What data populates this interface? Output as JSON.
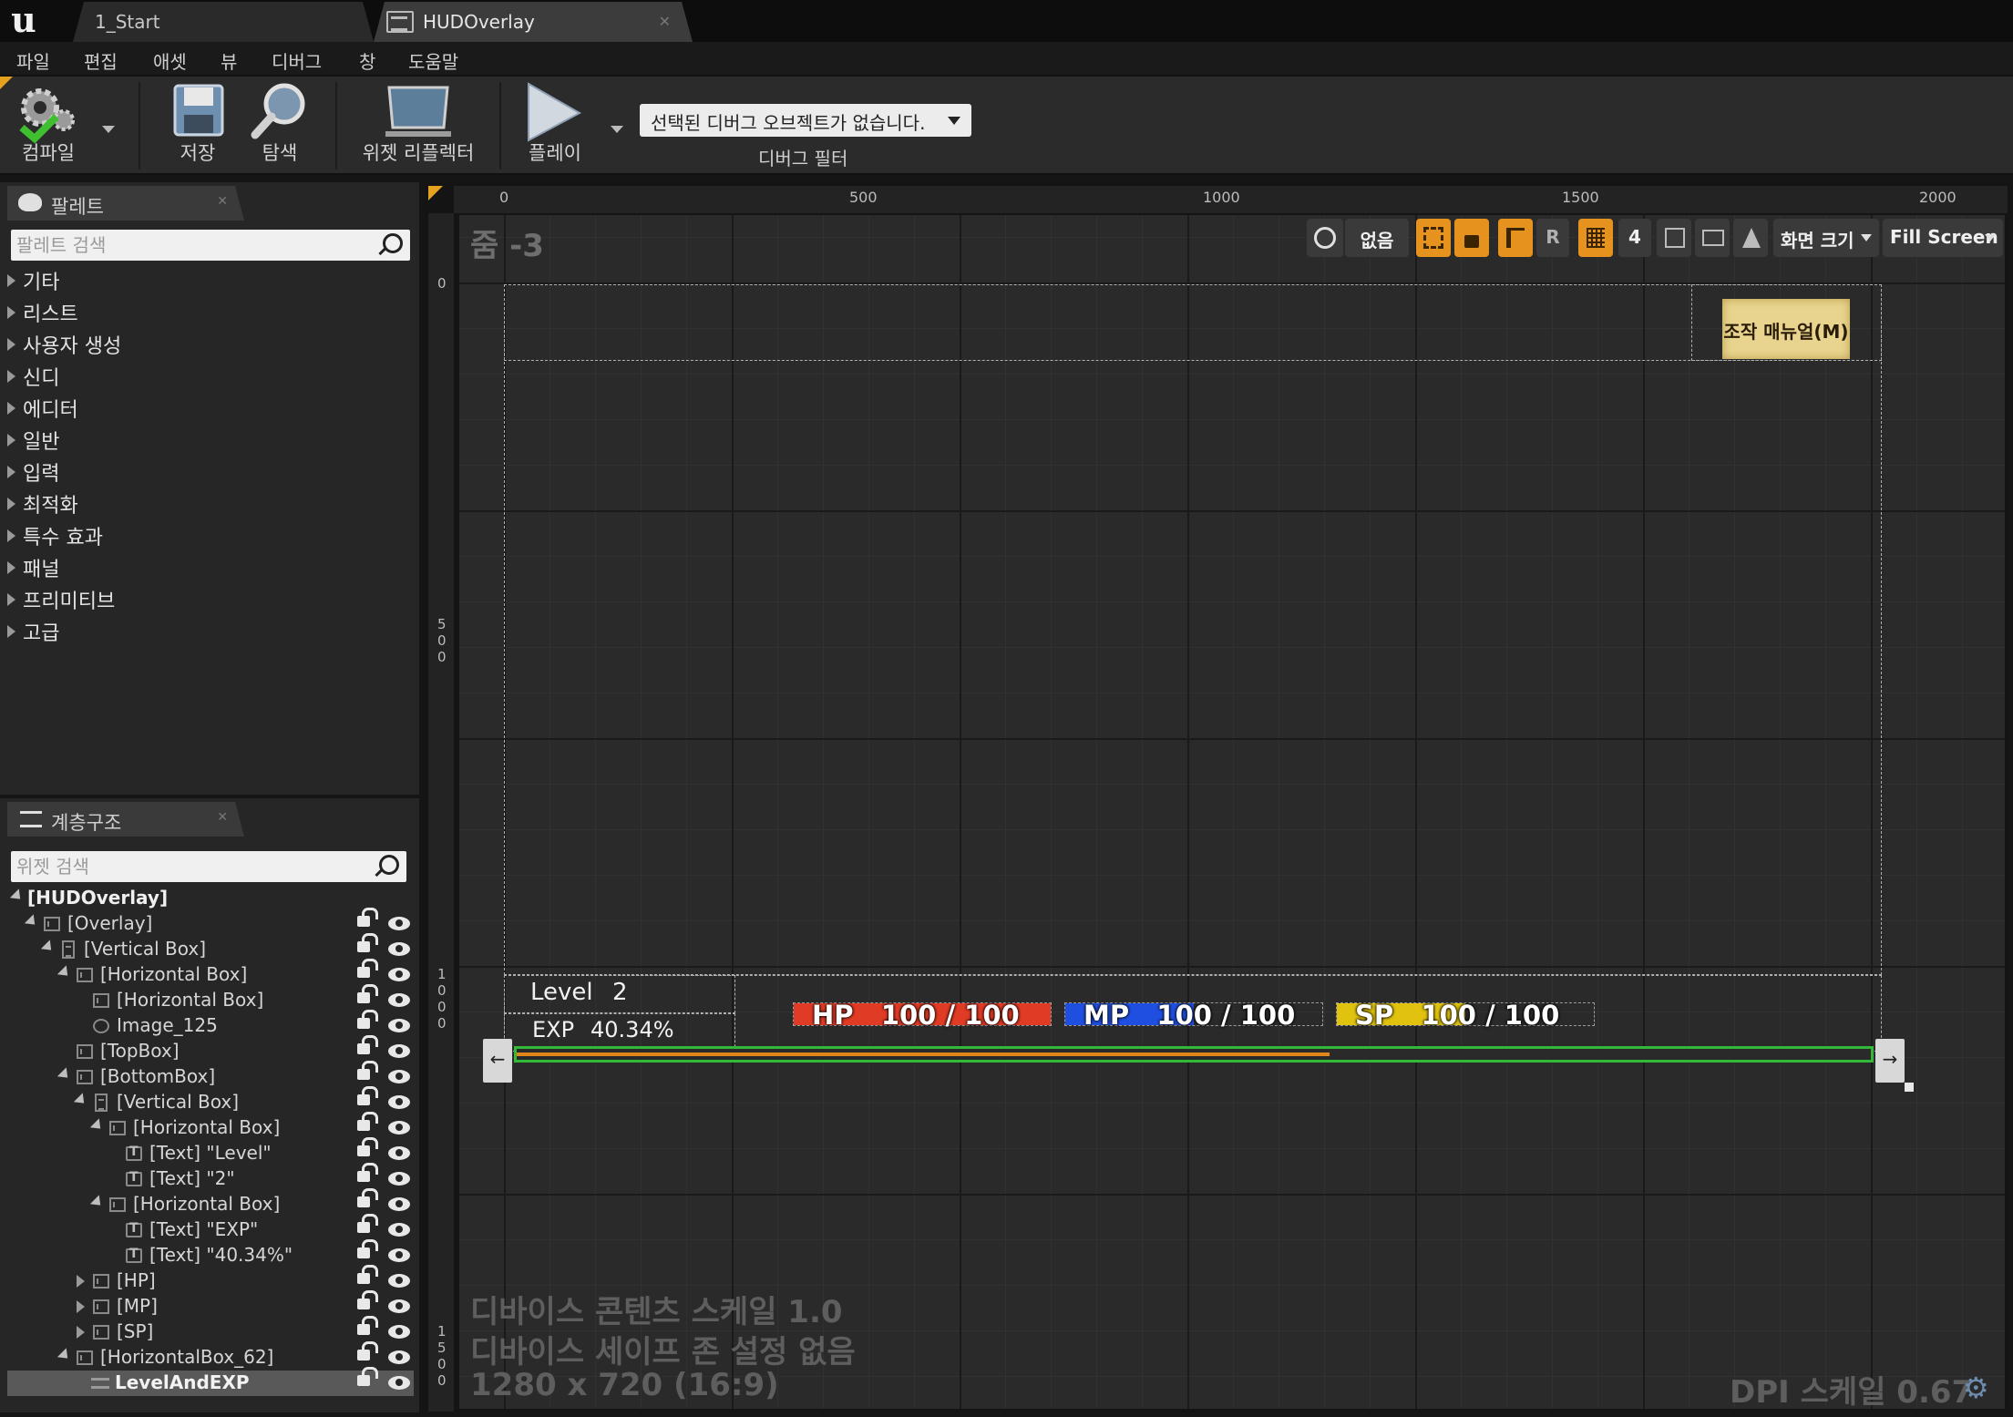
{
  "tabs": [
    {
      "label": "1_Start"
    },
    {
      "label": "HUDOverlay"
    }
  ],
  "menu": [
    "파일",
    "편집",
    "애셋",
    "뷰",
    "디버그",
    "창",
    "도움말"
  ],
  "toolbar": {
    "compile": "컴파일",
    "save": "저장",
    "browse": "탐색",
    "widget_reflector": "위젯 리플렉터",
    "play": "플레이",
    "debug_select": "선택된 디버그 오브젝트가 없습니다.",
    "debug_filter": "디버그 필터"
  },
  "palette": {
    "title": "팔레트",
    "search_placeholder": "팔레트 검색",
    "categories": [
      "기타",
      "리스트",
      "사용자 생성",
      "신디",
      "에디터",
      "일반",
      "입력",
      "최적화",
      "특수 효과",
      "패널",
      "프리미티브",
      "고급"
    ]
  },
  "hierarchy": {
    "title": "계층구조",
    "search_placeholder": "위젯 검색",
    "items": [
      {
        "label": "[HUDOverlay]"
      },
      {
        "label": "[Overlay]"
      },
      {
        "label": "[Vertical Box]"
      },
      {
        "label": "[Horizontal Box]"
      },
      {
        "label": "[Horizontal Box]"
      },
      {
        "label": "Image_125"
      },
      {
        "label": "[TopBox]"
      },
      {
        "label": "[BottomBox]"
      },
      {
        "label": "[Vertical Box]"
      },
      {
        "label": "[Horizontal Box]"
      },
      {
        "label": "[Text] \"Level\""
      },
      {
        "label": "[Text] \"2\""
      },
      {
        "label": "[Horizontal Box]"
      },
      {
        "label": "[Text] \"EXP\""
      },
      {
        "label": "[Text] \"40.34%\""
      },
      {
        "label": "[HP]"
      },
      {
        "label": "[MP]"
      },
      {
        "label": "[SP]"
      },
      {
        "label": "[HorizontalBox_62]"
      },
      {
        "label": "LevelAndEXP"
      }
    ]
  },
  "designer": {
    "zoom": "줌 -3",
    "ruler_top": [
      "0",
      "500",
      "1000",
      "1500",
      "2000"
    ],
    "ruler_left": [
      [
        "0"
      ],
      [
        "5",
        "0",
        "0"
      ],
      [
        "1",
        "0",
        "0",
        "0"
      ],
      [
        "1",
        "5",
        "0",
        "0"
      ]
    ],
    "tool_none": "없음",
    "tool_r": "R",
    "tool_grid_size": "4",
    "screen_size": "화면 크기",
    "fill_screen": "Fill Screen",
    "manual_button": "조작 매뉴얼(M)",
    "level_label": "Level",
    "level_value": "2",
    "exp_label": "EXP",
    "exp_value": "40.34%",
    "hp_label": "HP",
    "hp_value": "100 / 100",
    "mp_label": "MP",
    "mp_value": "100 / 100",
    "sp_label": "SP",
    "sp_value": "100 / 100",
    "device_scale": "디바이스 콘텐츠 스케일 1.0",
    "safe_zone": "디바이스 세이프 존 설정 없음",
    "resolution": "1280 x 720 (16:9)",
    "dpi_scale": "DPI 스케일 0.67",
    "colors": {
      "hp": "#e03b24",
      "mp": "#1f4fe0",
      "sp": "#e0c20f",
      "exp_orange": "#e0851a",
      "exp_green": "#34b83a",
      "manual_bg": "#e8d48e"
    }
  }
}
